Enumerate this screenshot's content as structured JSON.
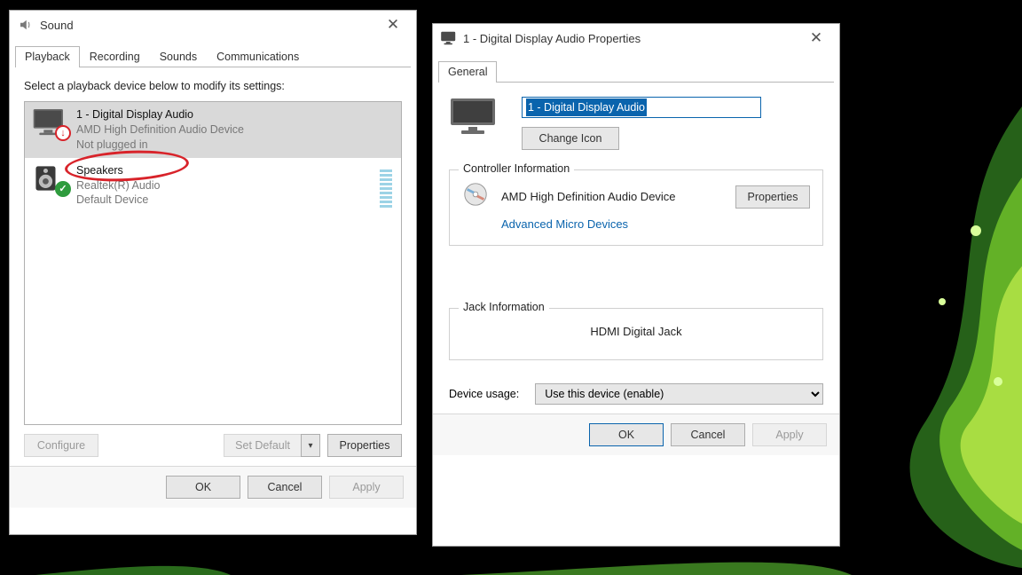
{
  "sound": {
    "title": "Sound",
    "tabs": [
      "Playback",
      "Recording",
      "Sounds",
      "Communications"
    ],
    "instruction": "Select a playback device below to modify its settings:",
    "devices": [
      {
        "name": "1 - Digital Display Audio",
        "sub": "AMD High Definition Audio Device",
        "status": "Not plugged in"
      },
      {
        "name": "Speakers",
        "sub": "Realtek(R) Audio",
        "status": "Default Device"
      }
    ],
    "buttons": {
      "configure": "Configure",
      "setdefault": "Set Default",
      "properties": "Properties"
    },
    "footer": {
      "ok": "OK",
      "cancel": "Cancel",
      "apply": "Apply"
    }
  },
  "props": {
    "title": "1 - Digital Display Audio Properties",
    "tab": "General",
    "name_value": "1 - Digital Display Audio",
    "change_icon": "Change Icon",
    "controller": {
      "legend": "Controller Information",
      "name": "AMD High Definition Audio Device",
      "vendor": "Advanced Micro Devices",
      "properties": "Properties"
    },
    "jack": {
      "legend": "Jack Information",
      "value": "HDMI Digital Jack"
    },
    "usage_label": "Device usage:",
    "usage_value": "Use this device (enable)",
    "footer": {
      "ok": "OK",
      "cancel": "Cancel",
      "apply": "Apply"
    }
  }
}
